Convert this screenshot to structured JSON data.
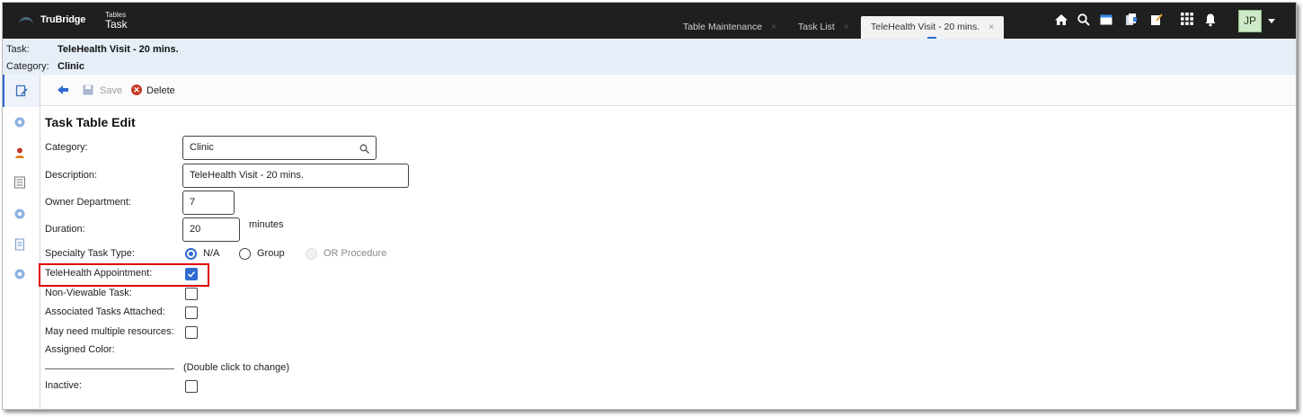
{
  "app": {
    "brand": "TruBridge",
    "context_small": "Tables",
    "context_big": "Task"
  },
  "tabs": [
    {
      "label": "Table Maintenance",
      "close": "×"
    },
    {
      "label": "Task List",
      "close": "×"
    },
    {
      "label": "TeleHealth Visit - 20 mins.",
      "close": "×"
    }
  ],
  "header_icons": [
    "home-icon",
    "search-icon",
    "window-icon",
    "documents-icon",
    "notes-icon",
    "apps-grid-icon",
    "bell-icon"
  ],
  "user": {
    "initials": "JP"
  },
  "info": {
    "task_label": "Task:",
    "task_value": "TeleHealth Visit - 20 mins.",
    "category_label": "Category:",
    "category_value": "Clinic"
  },
  "toolbar": {
    "save_label": "Save",
    "delete_label": "Delete"
  },
  "form": {
    "title": "Task Table Edit",
    "category_label": "Category:",
    "category_value": "Clinic",
    "description_label": "Description:",
    "description_value": "TeleHealth Visit - 20 mins.",
    "owner_label": "Owner Department:",
    "owner_value": "7",
    "duration_label": "Duration:",
    "duration_value": "20",
    "duration_unit": "minutes",
    "specialty_label": "Specialty Task Type:",
    "specialty_options": [
      "N/A",
      "Group",
      "OR Procedure"
    ],
    "specialty_selected": "N/A",
    "telehealth_label": "TeleHealth Appointment:",
    "telehealth_checked": true,
    "nonviewable_label": "Non-Viewable Task:",
    "nonviewable_checked": false,
    "associated_label": "Associated Tasks Attached:",
    "associated_checked": false,
    "multiple_label": "May need multiple resources:",
    "multiple_checked": false,
    "color_label": "Assigned Color:",
    "color_hint": "(Double click to change)",
    "inactive_label": "Inactive:",
    "inactive_checked": false
  },
  "colors": {
    "accent": "#2f6bd1",
    "topbar": "#1f1f1f",
    "infobar": "#e6eef7",
    "highlight": "#e00000"
  }
}
